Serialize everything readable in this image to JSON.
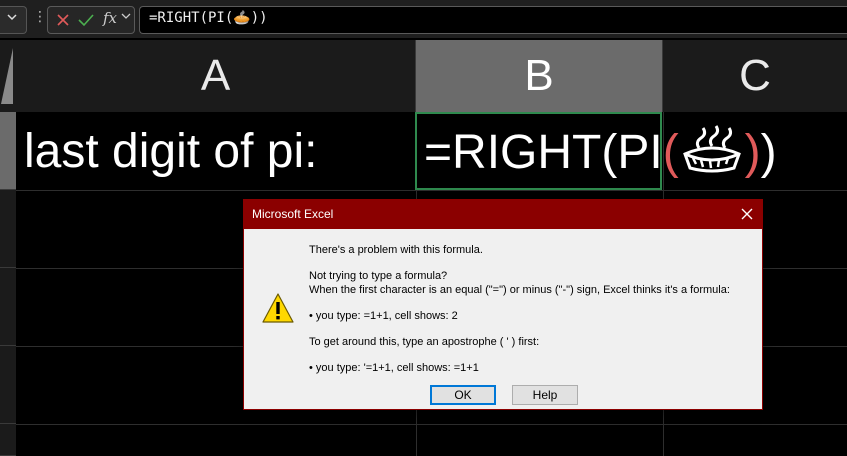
{
  "formula_bar": {
    "name_box_chevron": "chevron-down-icon",
    "more_menu": "⋮",
    "cancel_icon": "cross-icon",
    "enter_icon": "check-icon",
    "fx_label": "fx",
    "content": "=RIGHT(PI(🥧))"
  },
  "columns": [
    "A",
    "B",
    "C"
  ],
  "cells": {
    "A1": "last digit of pi:",
    "B1_prefix": "=RIGHT(PI",
    "B1_open_paren": "(",
    "B1_emoji_icon": "pie-icon",
    "B1_close_paren_red": ")",
    "B1_close_paren": ")"
  },
  "dialog": {
    "title": "Microsoft Excel",
    "icon": "warning-icon",
    "line1": "There's a problem with this formula.",
    "line2": "Not trying to type a formula?",
    "line3": "When the first character is an equal (\"=\") or minus (\"-\") sign, Excel thinks it's a formula:",
    "line4": "• you type:   =1+1, cell shows:   2",
    "line5": "To get around this, type an apostrophe ( ' ) first:",
    "line6": "• you type:   '=1+1, cell shows:   =1+1",
    "ok_label": "OK",
    "help_label": "Help"
  },
  "colors": {
    "dialog_title_bg": "#8b0000",
    "selected_cell_border": "#2f8a4e",
    "paren_red": "#e05a5a",
    "ok_button_border": "#0078d7"
  }
}
